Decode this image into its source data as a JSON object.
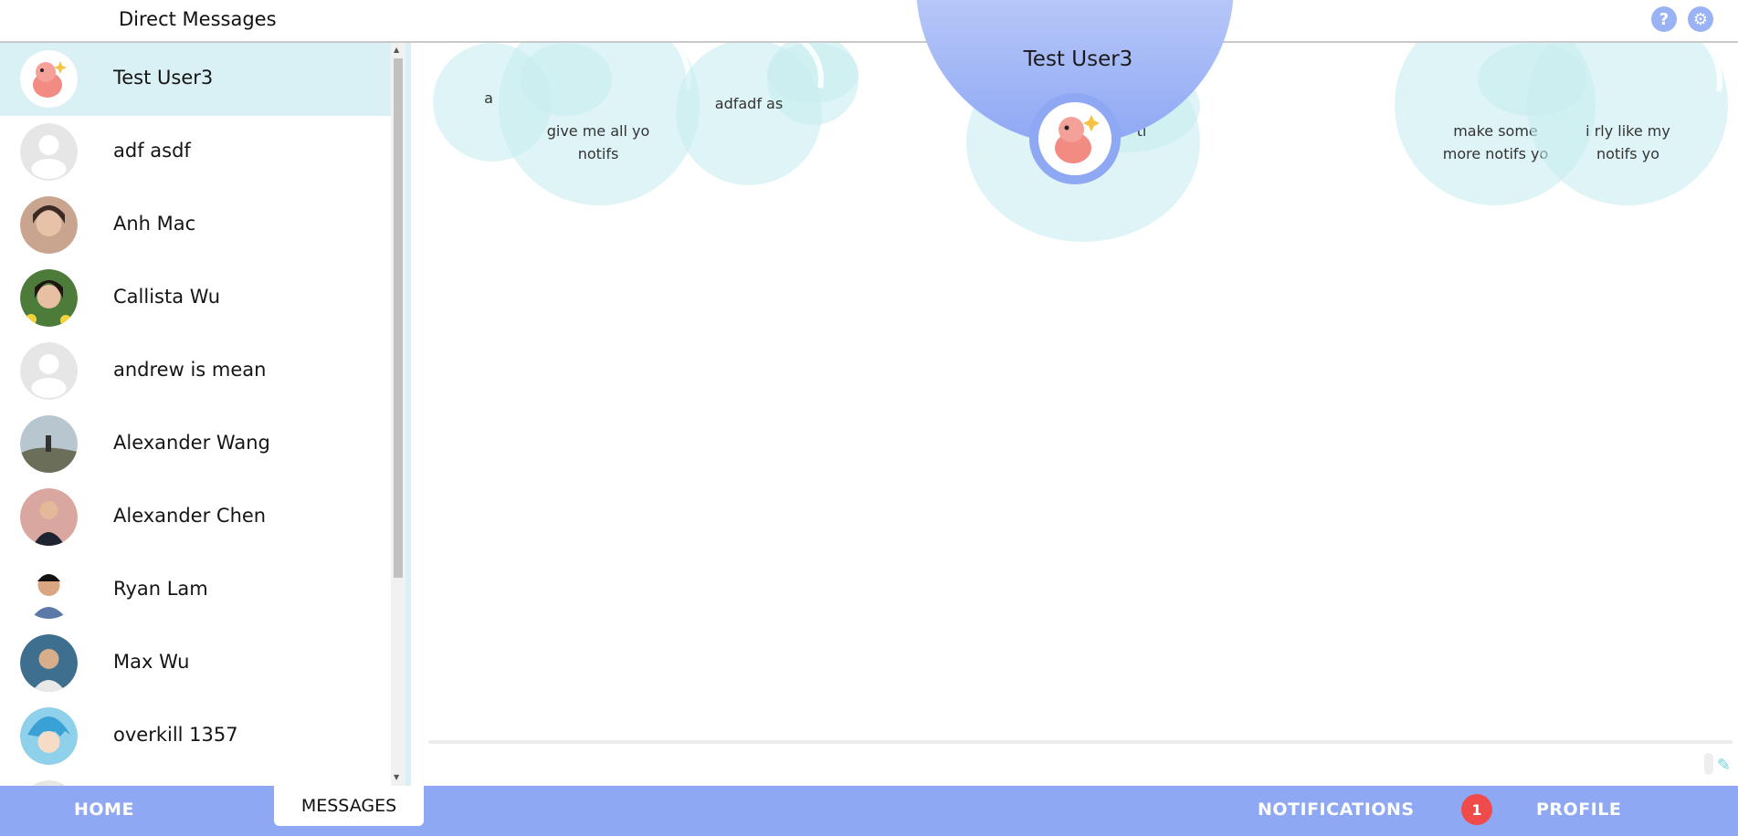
{
  "header": {
    "title": "Direct Messages",
    "help_icon": "?",
    "settings_icon": "⚙"
  },
  "contacts": [
    {
      "name": "Test User3",
      "avatar": "dragon",
      "selected": true
    },
    {
      "name": "adf asdf",
      "avatar": "default"
    },
    {
      "name": "Anh Mac",
      "avatar": "photo"
    },
    {
      "name": "Callista Wu",
      "avatar": "photo"
    },
    {
      "name": "andrew is mean",
      "avatar": "default"
    },
    {
      "name": "Alexander Wang",
      "avatar": "photo"
    },
    {
      "name": "Alexander Chen",
      "avatar": "photo"
    },
    {
      "name": "Ryan Lam",
      "avatar": "photo"
    },
    {
      "name": "Max Wu",
      "avatar": "photo"
    },
    {
      "name": "overkill 1357",
      "avatar": "photo"
    }
  ],
  "conversation": {
    "recipient": "Test User3",
    "bubbles": [
      {
        "text": "a"
      },
      {
        "text": "give me all yo notifs"
      },
      {
        "text": "adfadf as"
      },
      {
        "text": "ti"
      },
      {
        "text": "make some more notifs yo"
      },
      {
        "text": "i rly like my notifs yo"
      }
    ]
  },
  "nav": {
    "home": "HOME",
    "messages": "MESSAGES",
    "notifications": "NOTIFICATIONS",
    "notification_count": "1",
    "profile": "PROFILE"
  },
  "colors": {
    "accent": "#8fa8f4",
    "bubble": "#c8ecf0",
    "selected": "#d9f1f4",
    "badge": "#f14a4a"
  }
}
